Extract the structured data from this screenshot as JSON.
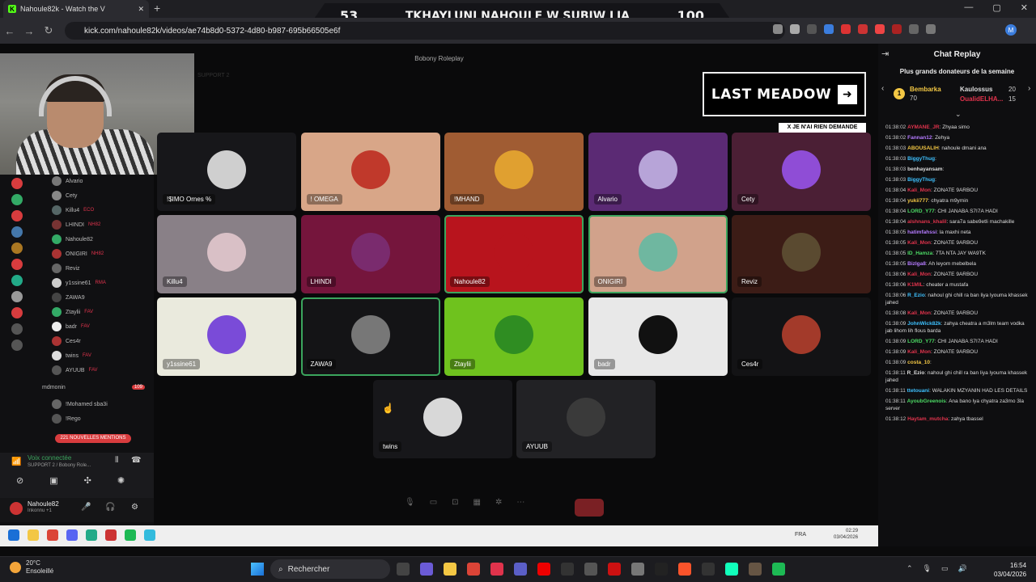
{
  "browser": {
    "tab_title": "Nahoule82k - Watch the V",
    "tab_icon": "kick-icon",
    "new_tab": "+",
    "url": "kick.com/nahoule82k/videos/ae74b8d0-5372-4d80-b987-695b66505e6f",
    "profile_initial": "M"
  },
  "scoreboard": {
    "left": "53",
    "title": "TKHAYLUNI NAHOULE W SUBIW LIA",
    "right": "100"
  },
  "window_controls": {
    "min": "—",
    "max": "▢",
    "close": "✕"
  },
  "discord": {
    "window_title": "Bobony Roleplay",
    "channel_header": "SUPPORT 2",
    "sidebar_users": [
      {
        "name": "Alvario",
        "badge": ""
      },
      {
        "name": "Cety",
        "badge": ""
      },
      {
        "name": "Killu4",
        "badge": "ECO"
      },
      {
        "name": "LHINDI",
        "badge": "NH82"
      },
      {
        "name": "Nahoule82",
        "badge": ""
      },
      {
        "name": "ONIGIRI",
        "badge": "NH82"
      },
      {
        "name": "Reviz",
        "badge": ""
      },
      {
        "name": "y1ssine61",
        "badge": "RMA"
      },
      {
        "name": "ZAWA9",
        "badge": ""
      },
      {
        "name": "Ztaylii",
        "badge": "FAV"
      },
      {
        "name": "badr",
        "badge": "FAV"
      },
      {
        "name": "Ces4r",
        "badge": ""
      },
      {
        "name": "twins",
        "badge": "FAV"
      },
      {
        "name": "AYUUB",
        "badge": "FAV"
      }
    ],
    "channel2": "mdmonin",
    "channel2_count": "109",
    "channel2_users": [
      "!Mohamed sba3i",
      "!Rego"
    ],
    "mentions": "221 NOUVELLES MENTIONS",
    "voice_status": "Voix connectée",
    "voice_sub": "SUPPORT 2 / Bobony Role...",
    "user_name": "Nahoule82",
    "user_status": "Inkonnu +1",
    "tiles": [
      {
        "label": "!$IMO Ornes %",
        "color": "#17171a",
        "av": "#cfcfcf"
      },
      {
        "label": "! OMEGA",
        "color": "#d8a688",
        "av": "#c0392b"
      },
      {
        "label": "!MHAND",
        "color": "#a05c33",
        "av": "#e0a030"
      },
      {
        "label": "Alvario",
        "color": "#5b2a74",
        "av": "#b7a4d8"
      },
      {
        "label": "Cety",
        "color": "#4b1f35",
        "av": "#8f4dd6"
      },
      {
        "label": "Killu4",
        "color": "#898087",
        "av": "#d9c0c6"
      },
      {
        "label": "LHINDI",
        "color": "#75153c",
        "av": "#7a2b6e"
      },
      {
        "label": "Nahoule82",
        "color": "#b8141d",
        "av": "#b8141d"
      },
      {
        "label": "ONIGIRI",
        "color": "#d1a28b",
        "av": "#6fb7a0"
      },
      {
        "label": "Reviz",
        "color": "#3c1c16",
        "av": "#5a4a30"
      },
      {
        "label": "y1ssine61",
        "color": "#eaeadd",
        "av": "#7a4bd8"
      },
      {
        "label": "ZAWA9",
        "color": "#141416",
        "av": "#777777"
      },
      {
        "label": "Ztaylii",
        "color": "#6fc21e",
        "av": "#2f8d22"
      },
      {
        "label": "badr",
        "color": "#e8e8e8",
        "av": "#111111"
      },
      {
        "label": "Ces4r",
        "color": "#131315",
        "av": "#a33a2a"
      },
      {
        "label": "twins",
        "color": "#17171a",
        "av": "#d8d8d8"
      },
      {
        "label": "AYUUB",
        "color": "#222225",
        "av": "#3a3a3a"
      }
    ],
    "overlay_title": "LAST MEADOW",
    "overlay_arrow": "➜",
    "overlay_sub": "X JE N'AI RIEN DEMANDE",
    "inner_clock": "02:29",
    "inner_date": "03/04/2026",
    "inner_lang": "FRA"
  },
  "chat": {
    "title": "Chat Replay",
    "donors_title": "Plus grands donateurs de la semaine",
    "donors": [
      {
        "rank": "1",
        "name": "Bembarka",
        "amount": "70"
      },
      {
        "name": "Kaulossus",
        "amount": "20"
      },
      {
        "name": "OualidELHA...",
        "amount": "15"
      }
    ],
    "messages": [
      {
        "time": "01:38:02",
        "user": "AYMANE_JR",
        "color": "#e0334c",
        "text": ": Zhyaa simo"
      },
      {
        "time": "01:38:02",
        "user": "Fannan12",
        "color": "#b57bff",
        "text": ": Zehya"
      },
      {
        "time": "01:38:03",
        "user": "ABOUSALIH",
        "color": "#f3c744",
        "text": ": nahoule dmani ana"
      },
      {
        "time": "01:38:03",
        "user": "BiggyThug",
        "color": "#3ec1ff",
        "text": ":"
      },
      {
        "time": "01:38:03",
        "user": "benhayansam",
        "color": "#dddddd",
        "text": ":"
      },
      {
        "time": "01:38:03",
        "user": "BiggyThug",
        "color": "#3ec1ff",
        "text": ":"
      },
      {
        "time": "01:38:04",
        "user": "Kali_Mon",
        "color": "#e0334c",
        "text": ": ZONATE 9ARBOU"
      },
      {
        "time": "01:38:04",
        "user": "yukii777",
        "color": "#f3c744",
        "text": ": chyatra m9ymin"
      },
      {
        "time": "01:38:04",
        "user": "LORD_Y77",
        "color": "#4cd964",
        "text": ": CHI JANABA S7I7A HADI"
      },
      {
        "time": "01:38:04",
        "user": "alshnans_khalil",
        "color": "#e0334c",
        "text": ": sara7a sabe9etli machakille"
      },
      {
        "time": "01:38:05",
        "user": "hatimfahssi",
        "color": "#b57bff",
        "text": ": la maxhi neta"
      },
      {
        "time": "01:38:05",
        "user": "Kali_Mon",
        "color": "#e0334c",
        "text": ": ZONATE 9ARBOU"
      },
      {
        "time": "01:38:05",
        "user": "ID_Hamza",
        "color": "#4cd964",
        "text": ": 7TA NTA JAY WA9TK"
      },
      {
        "time": "01:38:05",
        "user": "Bizlga8",
        "color": "#b57bff",
        "text": ": Ah leyom mebelbela"
      },
      {
        "time": "01:38:06",
        "user": "Kali_Mon",
        "color": "#e0334c",
        "text": ": ZONATE 9ARBOU"
      },
      {
        "time": "01:38:06",
        "user": "K1MIL",
        "color": "#e0334c",
        "text": ": cheater a mustafa"
      },
      {
        "time": "01:38:06",
        "user": "R_Ezio",
        "color": "#3ec1ff",
        "text": ": nahoul ghi chill ra ban liya lyouma khassek jahed"
      },
      {
        "time": "01:38:08",
        "user": "Kali_Mon",
        "color": "#e0334c",
        "text": ": ZONATE 9ARBOU"
      },
      {
        "time": "01:38:09",
        "user": "JohnWick82k",
        "color": "#3ec1ff",
        "text": ": zahya cheatra a m3lm team vodka jab lihom lih flous barda"
      },
      {
        "time": "01:38:09",
        "user": "LORD_Y77",
        "color": "#4cd964",
        "text": ": CHI JANABA S7I7A HADI"
      },
      {
        "time": "01:38:09",
        "user": "Kali_Mon",
        "color": "#e0334c",
        "text": ": ZONATE 9ARBOU"
      },
      {
        "time": "01:38:09",
        "user": "costa_10",
        "color": "#f3c744",
        "text": ":"
      },
      {
        "time": "01:38:11",
        "user": "R_Ezio",
        "color": "#dddddd",
        "text": ": nahoul ghi chill ra ban liya lyouma khassek jahed"
      },
      {
        "time": "01:38:11",
        "user": "ttetouani",
        "color": "#3ec1ff",
        "text": ": WALAKIN MZYANIN HAD LES DETAILS"
      },
      {
        "time": "01:38:11",
        "user": "AyoubGreenois",
        "color": "#4cd964",
        "text": ": Ana bano lya chyatra za3mo 3la server"
      },
      {
        "time": "01:38:12",
        "user": "Haytam_mutcha",
        "color": "#e0334c",
        "text": ": zahya tbassel"
      }
    ]
  },
  "taskbar": {
    "temp": "20°C",
    "weather": "Ensoleillé",
    "search": "Rechercher",
    "time": "16:54",
    "date": "03/04/2026"
  }
}
